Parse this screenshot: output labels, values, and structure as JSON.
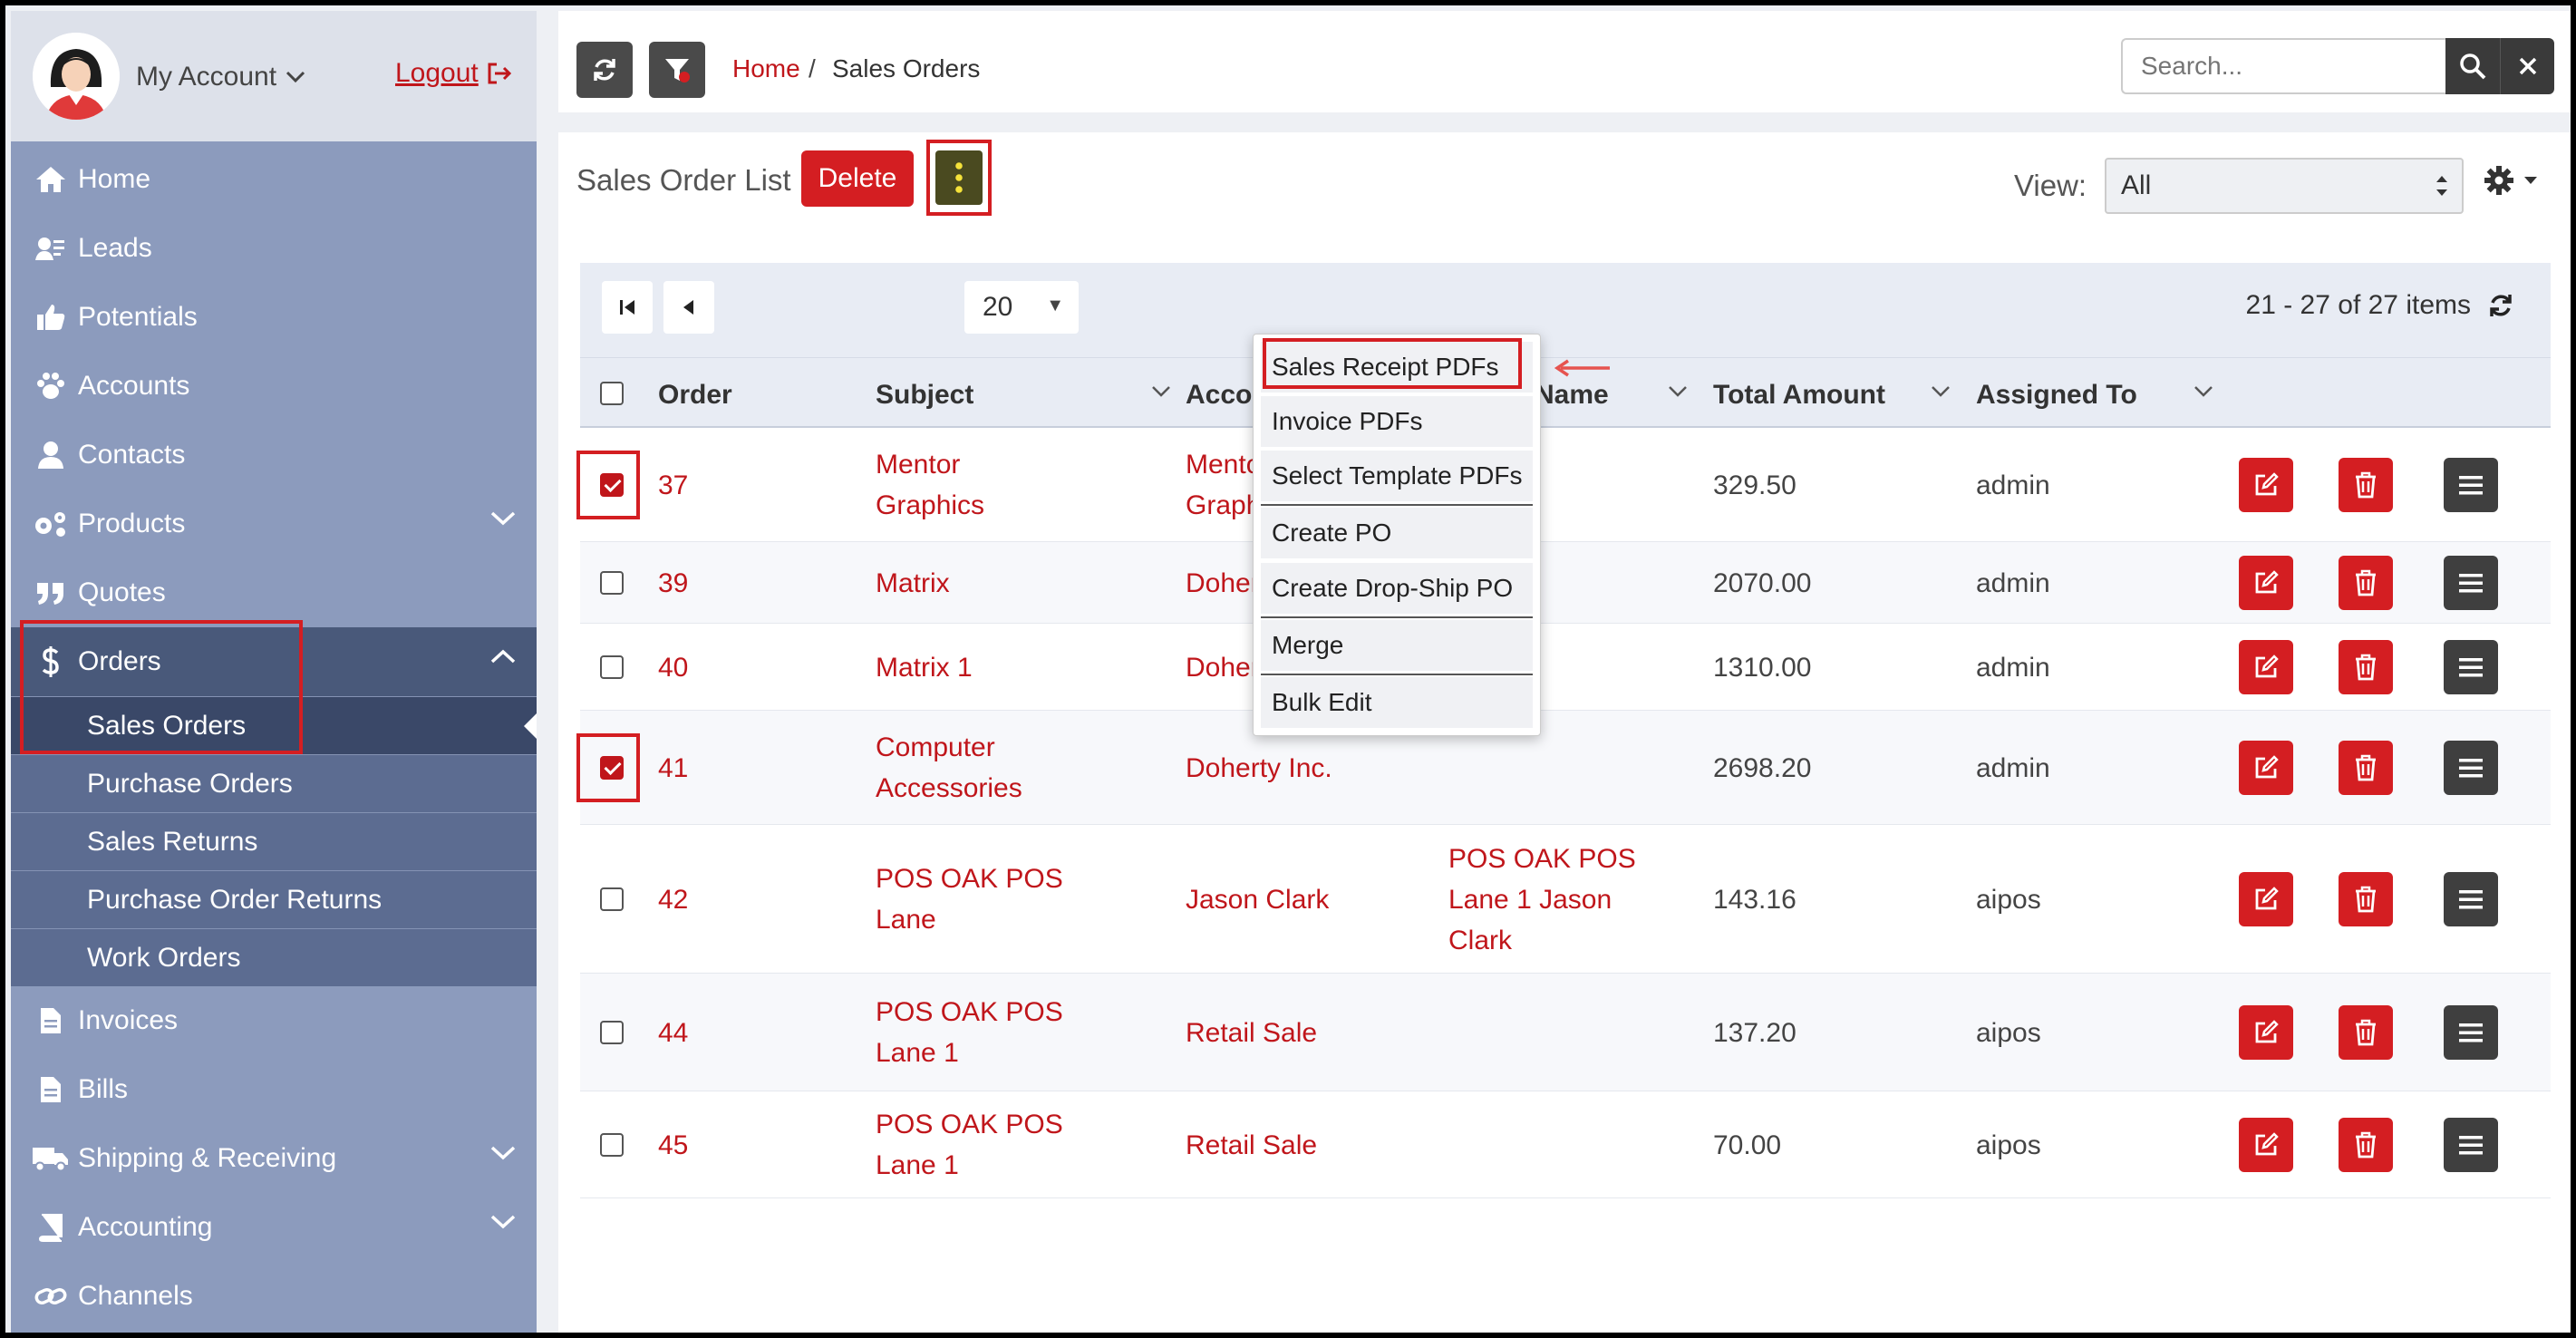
{
  "account": {
    "label": "My Account",
    "logout_label": "Logout"
  },
  "sidebar": {
    "items": [
      {
        "label": "Home",
        "icon": "home-icon"
      },
      {
        "label": "Leads",
        "icon": "leads-icon"
      },
      {
        "label": "Potentials",
        "icon": "thumbs-up-icon"
      },
      {
        "label": "Accounts",
        "icon": "paw-icon"
      },
      {
        "label": "Contacts",
        "icon": "user-icon"
      },
      {
        "label": "Products",
        "icon": "gears-icon"
      },
      {
        "label": "Quotes",
        "icon": "quote-icon"
      },
      {
        "label": "Orders",
        "icon": "dollar-icon"
      },
      {
        "label": "Invoices",
        "icon": "file-icon"
      },
      {
        "label": "Bills",
        "icon": "file-icon"
      },
      {
        "label": "Shipping & Receiving",
        "icon": "truck-icon"
      },
      {
        "label": "Accounting",
        "icon": "book-icon"
      },
      {
        "label": "Channels",
        "icon": "link-icon"
      }
    ],
    "orders_sub": [
      "Sales Orders",
      "Purchase Orders",
      "Sales Returns",
      "Purchase Order Returns",
      "Work Orders"
    ]
  },
  "breadcrumb": {
    "home": "Home",
    "separator": "/",
    "current": "Sales Orders"
  },
  "search": {
    "placeholder": "Search..."
  },
  "panel": {
    "title": "Sales Order List",
    "delete_label": "Delete",
    "view_label": "View:",
    "view_value": "All"
  },
  "pager": {
    "page_size": "20",
    "info": "21 - 27 of 27 items"
  },
  "columns": [
    "Order",
    "Subject",
    "Account Name",
    "Quote Name",
    "Total Amount",
    "Assigned To"
  ],
  "dropdown": [
    "Sales Receipt PDFs",
    "Invoice PDFs",
    "Select Template PDFs",
    "Create PO",
    "Create Drop-Ship PO",
    "Merge",
    "Bulk Edit"
  ],
  "rows": [
    {
      "id": "37",
      "subject": [
        "Mentor",
        "Graphics"
      ],
      "account": [
        "Mentor",
        "Graphics"
      ],
      "quote": [],
      "total": "329.50",
      "assigned": "admin",
      "checked": true
    },
    {
      "id": "39",
      "subject": [
        "Matrix"
      ],
      "account": [
        "Doherty Inc."
      ],
      "quote": [],
      "total": "2070.00",
      "assigned": "admin",
      "checked": false
    },
    {
      "id": "40",
      "subject": [
        "Matrix 1"
      ],
      "account": [
        "Doherty Inc."
      ],
      "quote": [],
      "total": "1310.00",
      "assigned": "admin",
      "checked": false
    },
    {
      "id": "41",
      "subject": [
        "Computer",
        "Accessories"
      ],
      "account": [
        "Doherty Inc."
      ],
      "quote": [],
      "total": "2698.20",
      "assigned": "admin",
      "checked": true
    },
    {
      "id": "42",
      "subject": [
        "POS OAK POS",
        "Lane"
      ],
      "account": [
        "Jason Clark"
      ],
      "quote": [
        "POS OAK POS",
        "Lane 1 Jason",
        "Clark"
      ],
      "total": "143.16",
      "assigned": "aipos",
      "checked": false
    },
    {
      "id": "44",
      "subject": [
        "POS OAK POS",
        "Lane 1"
      ],
      "account": [
        "Retail Sale"
      ],
      "quote": [],
      "total": "137.20",
      "assigned": "aipos",
      "checked": false
    },
    {
      "id": "45",
      "subject": [
        "POS OAK POS",
        "Lane 1"
      ],
      "account": [
        "Retail Sale"
      ],
      "quote": [],
      "total": "70.00",
      "assigned": "aipos",
      "checked": false
    }
  ],
  "colors": {
    "accent": "#d41e22",
    "sidebar": "#8c9bbd",
    "sidebar_active": "#49597a"
  }
}
